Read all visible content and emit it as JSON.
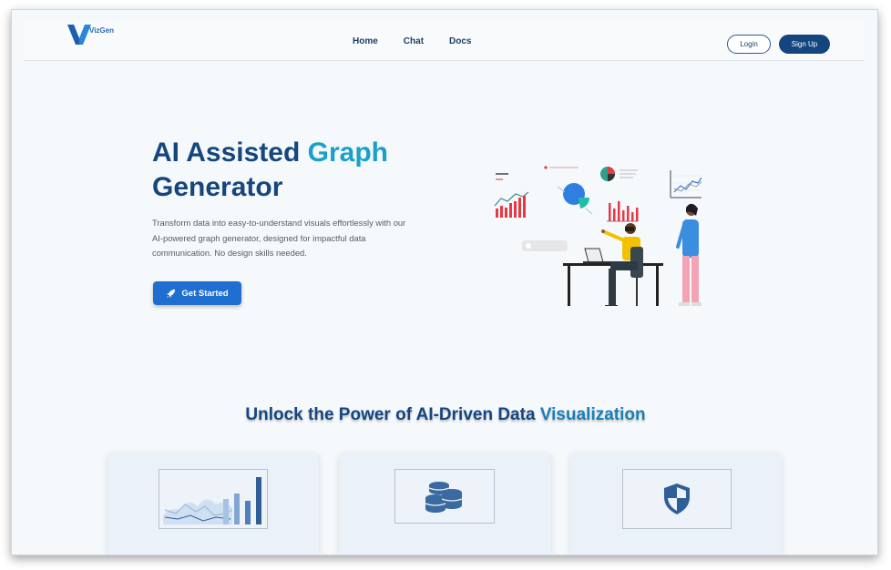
{
  "brand": {
    "logo_text": "VizGen"
  },
  "nav": {
    "links": [
      "Home",
      "Chat",
      "Docs"
    ],
    "login": "Login",
    "signup": "Sign Up"
  },
  "hero": {
    "title_part1": "AI Assisted ",
    "title_accent": "Graph",
    "title_part2": "Generator",
    "description": "Transform data into easy-to-understand visuals effortlessly with our AI-powered graph generator, designed for impactful data communication. No design skills needed.",
    "cta": "Get Started",
    "cta_icon": "rocket-icon"
  },
  "features": {
    "title_part1": "Unlock the Power of AI-Driven Data ",
    "title_accent": "Visualization",
    "cards": [
      {
        "icon": "chart-icon"
      },
      {
        "icon": "database-icon"
      },
      {
        "icon": "shield-icon"
      }
    ]
  },
  "colors": {
    "primary": "#15467e",
    "accent": "#1aa0c8",
    "button": "#1f6fd1",
    "background": "#f6f9fc"
  }
}
